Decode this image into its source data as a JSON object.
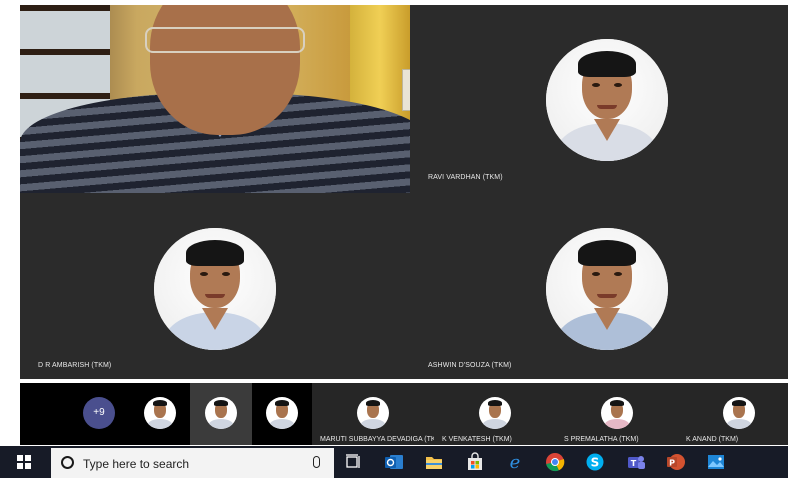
{
  "participants": {
    "top_right": "RAVI VARDHAN (TKM)",
    "bottom_left": "D R AMBARISH (TKM)",
    "bottom_right": "ASHWIN D'SOUZA (TKM)"
  },
  "filmstrip": {
    "overflow_count": "+9",
    "named": [
      "MARUTI SUBBAYYA DEVADIGA (TKM)",
      "K VENKATESH (TKM)",
      "S PREMALATHA (TKM)",
      "K ANAND (TKM)"
    ]
  },
  "taskbar": {
    "search_placeholder": "Type here to search",
    "icons": [
      "windows-start-icon",
      "cortana-icon",
      "microphone-icon",
      "task-view-icon",
      "outlook-icon",
      "file-explorer-icon",
      "store-icon",
      "edge-icon",
      "chrome-icon",
      "skype-icon",
      "teams-icon",
      "powerpoint-icon",
      "photos-icon"
    ]
  },
  "colors": {
    "tile_bg": "#2b2b2b",
    "strip_bg": "#000000",
    "taskbar_bg": "#171b27",
    "overflow_badge": "#4a4f8e"
  }
}
